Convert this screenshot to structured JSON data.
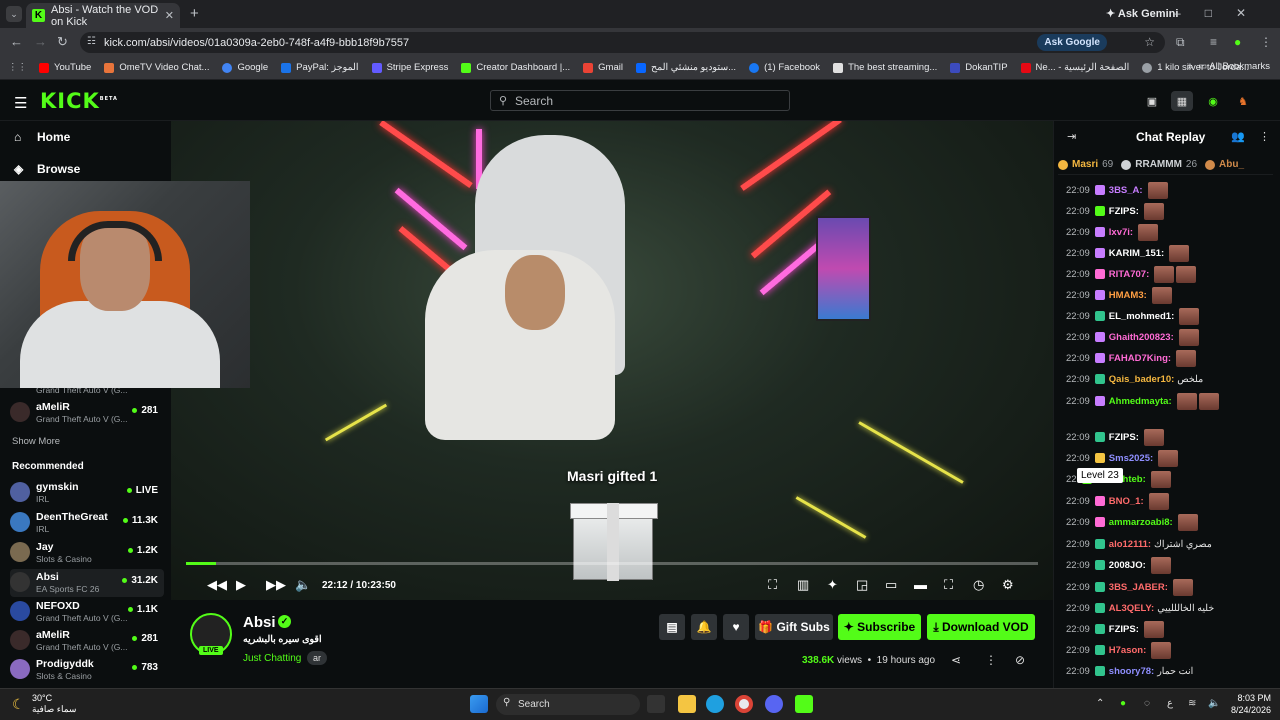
{
  "browser": {
    "tab_title": "Absi - Watch the VOD on Kick",
    "ask_gemini": "Ask Gemini",
    "url": "kick.com/absi/videos/01a0309a-2eb0-748f-a4f9-bbb18f9b7557",
    "ask_google": "Ask Google",
    "bookmarks": [
      "YouTube",
      "OmeTV Video Chat...",
      "Google",
      "PayPal: الموجز",
      "Stripe Express",
      "Creator Dashboard |...",
      "Gmail",
      "ستوديو منشئي المح...",
      "(1) Facebook",
      "The best streaming...",
      "DokanTIP",
      "Ne... - الصفحة الرئيسية",
      "1 kilo silver to Jorda..."
    ],
    "all_bookmarks": "All Bookmarks"
  },
  "kick": {
    "logo": "KICK",
    "beta": "BETA",
    "search_placeholder": "Search"
  },
  "sidebar": {
    "nav": [
      {
        "label": "Home"
      },
      {
        "label": "Browse"
      }
    ],
    "following_partial": [
      {
        "game": "Grand Theft Auto V (G..."
      },
      {
        "name": "aMeliR",
        "game": "Grand Theft Auto V (G...",
        "viewers": "281"
      }
    ],
    "show_more": "Show More",
    "recommended_title": "Recommended",
    "recommended": [
      {
        "name": "gymskin",
        "game": "IRL",
        "viewers": "LIVE"
      },
      {
        "name": "DeenTheGreat",
        "game": "IRL",
        "viewers": "11.3K"
      },
      {
        "name": "Jay",
        "game": "Slots & Casino",
        "viewers": "1.2K"
      },
      {
        "name": "Absi",
        "game": "EA Sports FC 26",
        "viewers": "31.2K"
      },
      {
        "name": "NEFOXD",
        "game": "Grand Theft Auto V (G...",
        "viewers": "1.1K"
      },
      {
        "name": "aMeliR",
        "game": "Grand Theft Auto V (G...",
        "viewers": "281"
      },
      {
        "name": "Prodigyddk",
        "game": "Slots & Casino",
        "viewers": "783"
      }
    ]
  },
  "player": {
    "gift_text": "Masri gifted 1",
    "current_time": "22:12",
    "duration": "10:23:50",
    "progress_fraction": 0.035
  },
  "channel": {
    "name": "Absi",
    "live_badge": "LIVE",
    "stream_title": "اقوى سيره بالبشريه",
    "category": "Just Chatting",
    "language": "ar",
    "gift_subs": "Gift Subs",
    "subscribe": "Subscribe",
    "download": "Download VOD",
    "views": "338.6K",
    "views_label": "views",
    "ago": "19 hours ago"
  },
  "chat": {
    "title": "Chat Replay",
    "pinned": [
      {
        "name": "Masri",
        "count": "69",
        "color": "#f4b740"
      },
      {
        "name": "RRAMMM",
        "count": "26",
        "color": "#cfd3d6"
      },
      {
        "name": "Abu_",
        "count": "",
        "color": "#d08a4a"
      }
    ],
    "tooltip": "Level 23",
    "messages": [
      {
        "t": "22:09",
        "u": "3BS_A:",
        "c": "#c77dff",
        "tx": ""
      },
      {
        "t": "22:09",
        "u": "FZIPS:",
        "c": "#ffffff",
        "tx": ""
      },
      {
        "t": "22:09",
        "u": "lxv7i:",
        "c": "#ff6bd5",
        "tx": ""
      },
      {
        "t": "22:09",
        "u": "KARIM_151:",
        "c": "#ffffff",
        "tx": ""
      },
      {
        "t": "22:09",
        "u": "RITA707:",
        "c": "#ff6bd5",
        "tx": ""
      },
      {
        "t": "22:09",
        "u": "HMAM3:",
        "c": "#ff9f43",
        "tx": ""
      },
      {
        "t": "22:09",
        "u": "EL_mohmed1:",
        "c": "#ffffff",
        "tx": ""
      },
      {
        "t": "22:09",
        "u": "Ghaith200823:",
        "c": "#ff6bd5",
        "tx": ""
      },
      {
        "t": "22:09",
        "u": "FAHAD7King:",
        "c": "#ff6bd5",
        "tx": ""
      },
      {
        "t": "22:09",
        "u": "Qais_bader10:",
        "c": "#f4b740",
        "tx": "ملخص"
      },
      {
        "t": "22:09",
        "u": "Ahmedmayta:",
        "c": "#53fc18",
        "tx": ""
      },
      {
        "t": "22:09",
        "u": "FZIPS:",
        "c": "#ffffff",
        "tx": ""
      },
      {
        "t": "22:09",
        "u": "Sms2025:",
        "c": "#8f8fff",
        "tx": ""
      },
      {
        "t": "22",
        "u": "belalkhteb:",
        "c": "#53fc18",
        "tx": ""
      },
      {
        "t": "22:09",
        "u": "BNO_1:",
        "c": "#ff6b6b",
        "tx": ""
      },
      {
        "t": "22:09",
        "u": "ammarzoabi8:",
        "c": "#53fc18",
        "tx": ""
      },
      {
        "t": "22:09",
        "u": "alo12111:",
        "c": "#ff6b6b",
        "tx": "مصري اشتراك"
      },
      {
        "t": "22:09",
        "u": "2008JO:",
        "c": "#ffffff",
        "tx": ""
      },
      {
        "t": "22:09",
        "u": "3BS_JABER:",
        "c": "#ff6b6b",
        "tx": ""
      },
      {
        "t": "22:09",
        "u": "AL3QELY:",
        "c": "#ff6b6b",
        "tx": "خليه الخالللييي"
      },
      {
        "t": "22:09",
        "u": "FZIPS:",
        "c": "#ffffff",
        "tx": ""
      },
      {
        "t": "22:09",
        "u": "H7ason:",
        "c": "#ff6b6b",
        "tx": ""
      },
      {
        "t": "22:09",
        "u": "shoory78:",
        "c": "#8f8fff",
        "tx": "انت حمار"
      }
    ]
  },
  "taskbar": {
    "temp": "30°C",
    "weather": "سماء صافية",
    "search": "Search",
    "time": "8:03 PM",
    "date": "8/24/2026"
  },
  "colors": {
    "accent": "#53fc18",
    "bg": "#0b0e0f"
  }
}
